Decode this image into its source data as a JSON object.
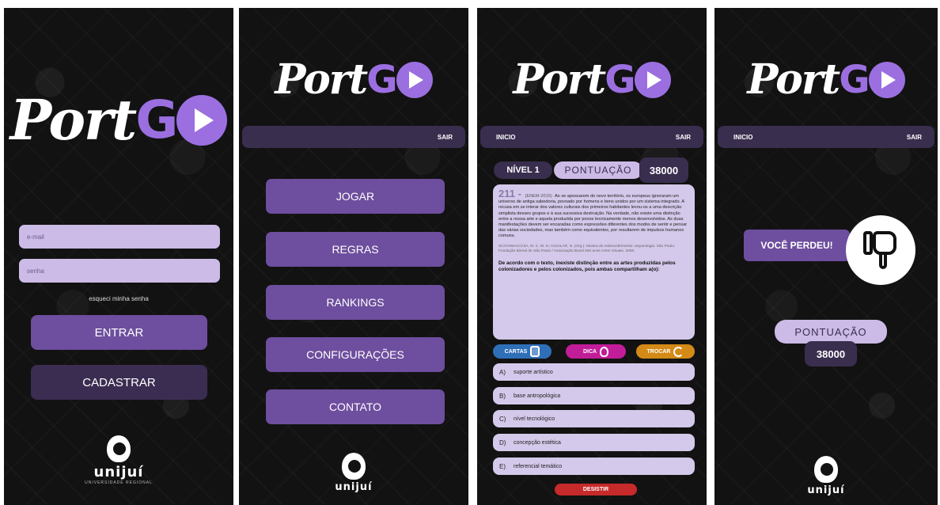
{
  "logo": {
    "port": "Port",
    "go": "GO"
  },
  "institution": {
    "name": "unijuí",
    "sub": "UNIVERSIDADE REGIONAL"
  },
  "login": {
    "email_placeholder": "e-mail",
    "password_placeholder": "senha",
    "forgot": "esqueci minha senha",
    "enter": "ENTRAR",
    "register": "CADASTRAR"
  },
  "menu": {
    "logout": "SAIR",
    "items": [
      "JOGAR",
      "REGRAS",
      "RANKINGS",
      "CONFIGURAÇÕES",
      "CONTATO"
    ]
  },
  "game": {
    "home": "INICIO",
    "logout": "SAIR",
    "level": "NÍVEL 1",
    "score_label": "PONTUAÇÃO",
    "score": "38000",
    "question": {
      "number": "211 -",
      "source": "(ENEM-2015)",
      "text": "Ao se apossarem do novo território, os europeus ignoraram um universo de antiga sabedoria, povoado por homens e bens unidos por um sistema integrado. A recusa em se interar dos valores culturais dos primeiros habitantes levou-os a uma descrição simplista desses grupos e à sua sucessiva destruição. Na verdade, não existe uma distinção entre a nossa arte e aquela produzida por povos tecnicamente menos desenvolvidos. As duas manifestações devem ser encaradas como expressões diferentes dos modos de sentir e pensar das várias sociedades, mas também como equivalentes, por resultarem de impulsos humanos comuns.",
      "reference": "SCATAMACCHIA, M. C. M. In: AGUILAR, N. (Org.). Mostra do redescobrimento: arqueologia. São Paulo: Fundação Bienal de São Paulo / Associação Brasil 500 anos Artes Visuais, 2000.",
      "prompt": "De acordo com o texto, inexiste distinção entre as artes produzidas pelos colonizadores e pelos colonizados, pois ambas compartilham a(o):"
    },
    "powerups": {
      "cards": "CARTAS",
      "hint": "DICA",
      "swap": "TROCAR"
    },
    "options": [
      {
        "letter": "A)",
        "text": "suporte artístico"
      },
      {
        "letter": "B)",
        "text": "base antropológica"
      },
      {
        "letter": "C)",
        "text": "nível tecnológico"
      },
      {
        "letter": "D)",
        "text": "concepção estética"
      },
      {
        "letter": "E)",
        "text": "referencial temático"
      }
    ],
    "quit": "DESISTIR"
  },
  "result": {
    "home": "INICIO",
    "logout": "SAIR",
    "message": "VOCÊ PERDEU!",
    "score_label": "PONTUAÇÃO",
    "score": "38000"
  },
  "colors": {
    "background": "#121212",
    "accent_purple": "#9b6fe0",
    "button_purple": "#6e4e9e",
    "light_lilac": "#cbbbe6",
    "dark_bar": "#3a2e4f",
    "cards_blue": "#2f6fb8",
    "hint_magenta": "#c21d99",
    "swap_orange": "#d48a16",
    "quit_red": "#c62a2a"
  }
}
